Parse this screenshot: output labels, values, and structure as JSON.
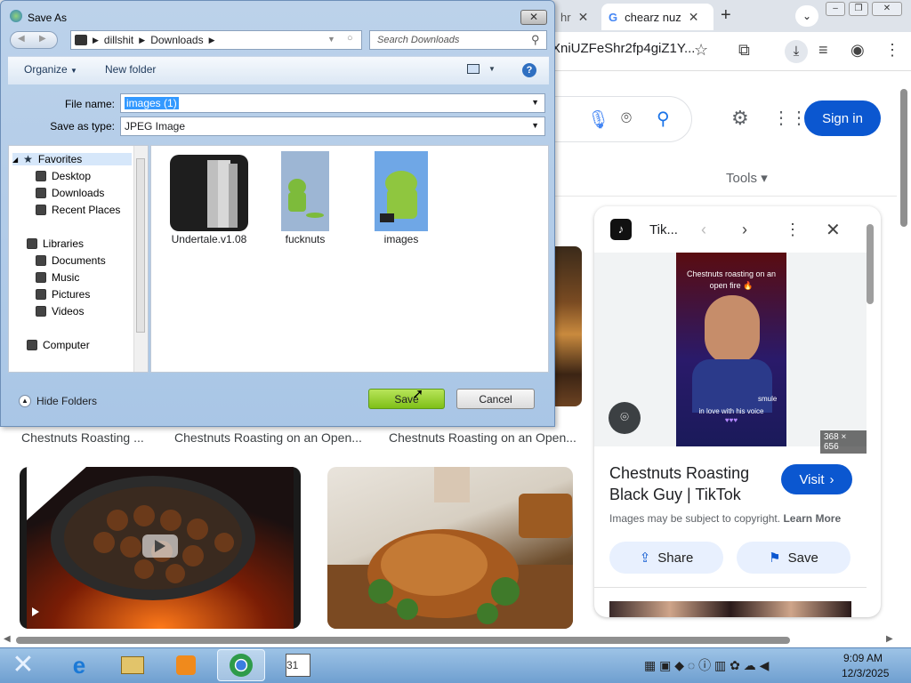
{
  "browser": {
    "tabs": [
      {
        "label": "hr",
        "active": false
      },
      {
        "label": "chearz nuz",
        "active": true
      }
    ],
    "new_tab": "+",
    "url": "XniUZFeShr2fp4giZ1Y..."
  },
  "google": {
    "sign_in": "Sign in",
    "tools": "Tools",
    "captions": [
      "Chestnuts Roasting ...",
      "Chestnuts Roasting on an Open...",
      "Chestnuts Roasting on an Open..."
    ],
    "panel": {
      "source_label": "Tik...",
      "image_caption_top": "Chestnuts roasting on an open fire 🔥",
      "image_caption_bottom": "in love with his voice",
      "image_watermark": "smule",
      "image_size": "368 × 656",
      "title": "Chestnuts Roasting Black Guy | TikTok",
      "visit": "Visit",
      "copyright": "Images may be subject to copyright.",
      "learn_more": "Learn More",
      "share": "Share",
      "save": "Save"
    }
  },
  "dialog": {
    "title": "Save As",
    "breadcrumb": [
      "dillshit",
      "Downloads"
    ],
    "search_placeholder": "Search Downloads",
    "organize": "Organize",
    "new_folder": "New folder",
    "file_name_label": "File name:",
    "file_name_value": "images (1)",
    "save_type_label": "Save as type:",
    "save_type_value": "JPEG Image",
    "tree": {
      "favorites": "Favorites",
      "desktop": "Desktop",
      "downloads": "Downloads",
      "recent": "Recent Places",
      "libraries": "Libraries",
      "documents": "Documents",
      "music": "Music",
      "pictures": "Pictures",
      "videos": "Videos",
      "computer": "Computer"
    },
    "files": [
      {
        "name": "Undertale.v1.08"
      },
      {
        "name": "fucknuts"
      },
      {
        "name": "images"
      }
    ],
    "hide_folders": "Hide Folders",
    "save": "Save",
    "cancel": "Cancel"
  },
  "taskbar": {
    "time": "9:09 AM",
    "date": "12/3/2025"
  },
  "colors": {
    "accent": "#0b57d0",
    "save_green": "#8cc63f",
    "taskbar": "#7ba7d6"
  }
}
